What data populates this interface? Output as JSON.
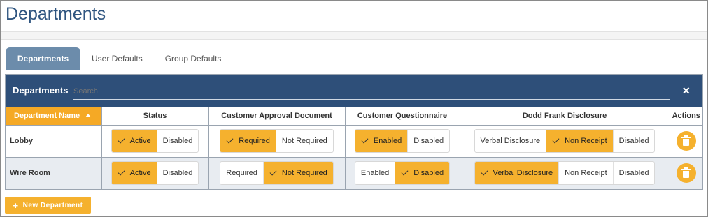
{
  "page": {
    "title": "Departments"
  },
  "tabs": [
    {
      "label": "Departments",
      "active": true
    },
    {
      "label": "User Defaults",
      "active": false
    },
    {
      "label": "Group Defaults",
      "active": false
    }
  ],
  "panel": {
    "title": "Departments",
    "search_label": "Search",
    "close_icon": "×"
  },
  "table": {
    "headers": {
      "name": "Department Name",
      "status": "Status",
      "approval": "Customer Approval Document",
      "questionnaire": "Customer Questionnaire",
      "dodd_frank": "Dodd Frank Disclosure",
      "actions": "Actions"
    },
    "rows": [
      {
        "name": "Lobby",
        "status": {
          "options": [
            "Active",
            "Disabled"
          ],
          "selected": "Active"
        },
        "approval": {
          "options": [
            "Required",
            "Not Required"
          ],
          "selected": "Required"
        },
        "questionnaire": {
          "options": [
            "Enabled",
            "Disabled"
          ],
          "selected": "Enabled"
        },
        "dodd_frank": {
          "options": [
            "Verbal Disclosure",
            "Non Receipt",
            "Disabled"
          ],
          "selected": "Non Receipt"
        }
      },
      {
        "name": "Wire Room",
        "status": {
          "options": [
            "Active",
            "Disabled"
          ],
          "selected": "Active"
        },
        "approval": {
          "options": [
            "Required",
            "Not Required"
          ],
          "selected": "Not Required"
        },
        "questionnaire": {
          "options": [
            "Enabled",
            "Disabled"
          ],
          "selected": "Disabled"
        },
        "dodd_frank": {
          "options": [
            "Verbal Disclosure",
            "Non Receipt",
            "Disabled"
          ],
          "selected": "Verbal Disclosure"
        }
      }
    ]
  },
  "new_button": {
    "label": "New Department",
    "icon": "+"
  },
  "colors": {
    "accent": "#f5b12e",
    "header": "#2e4f79",
    "active_tab": "#6c8cab",
    "title": "#2f5580"
  }
}
